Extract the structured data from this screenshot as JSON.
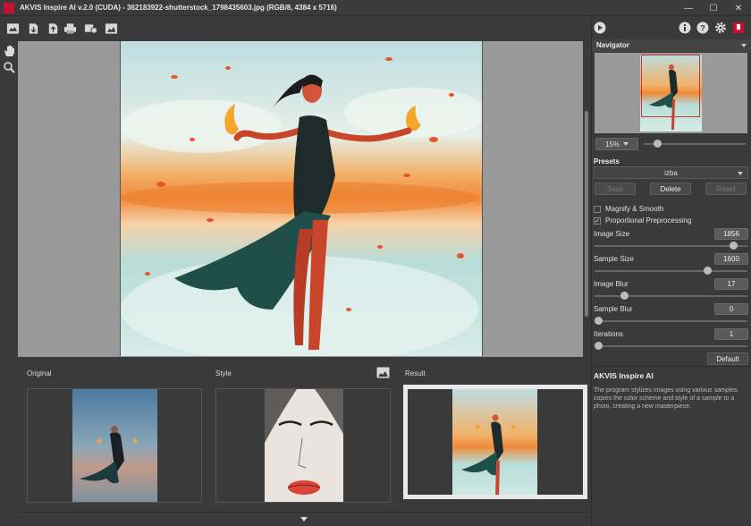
{
  "window": {
    "title": "AKVIS Inspire AI v.2.0 (CUDA) - 362183922-shutterstock_1798435603.jpg (RGB/8, 4384 x 5716)",
    "minimize": "—",
    "maximize": "☐",
    "close": "✕"
  },
  "toolbar": {
    "icons": [
      "open-image-icon",
      "save-import-icon",
      "save-export-icon",
      "print-icon",
      "batch-icon",
      "image-icon"
    ]
  },
  "right_toolbar": {
    "icons": [
      "run-icon",
      "info-icon",
      "help-icon",
      "settings-icon",
      "bookmark-icon"
    ]
  },
  "left_tools": [
    "hand-icon",
    "zoom-icon"
  ],
  "thumbnails": {
    "original_label": "Original",
    "style_label": "Style",
    "result_label": "Result"
  },
  "navigator": {
    "title": "Navigator",
    "zoom": "15%",
    "zoom_level": 0.1
  },
  "presets": {
    "label": "Presets",
    "selected": "izba",
    "save": "Save",
    "delete": "Delete",
    "reset": "Reset"
  },
  "options": {
    "magnify_smooth": {
      "label": "Magnify & Smooth",
      "checked": false
    },
    "proportional": {
      "label": "Proportional Preprocessing",
      "checked": true
    }
  },
  "params": [
    {
      "label": "Image Size",
      "value": "1856",
      "level": 0.93
    },
    {
      "label": "Sample Size",
      "value": "1600",
      "level": 0.75
    },
    {
      "label": "Image Blur",
      "value": "17",
      "level": 0.18
    },
    {
      "label": "Sample Blur",
      "value": "0",
      "level": 0.0
    },
    {
      "label": "Iterations",
      "value": "1",
      "level": 0.0
    }
  ],
  "default_button": "Default",
  "info": {
    "title": "AKVIS Inspire AI",
    "text": "The program stylizes images using various samples, copies the color scheme and style of a sample to a photo, creating a new masterpiece."
  },
  "colors": {
    "background": "#3a3a3a",
    "canvas_bg": "#999999",
    "accent": "#c8102e"
  }
}
